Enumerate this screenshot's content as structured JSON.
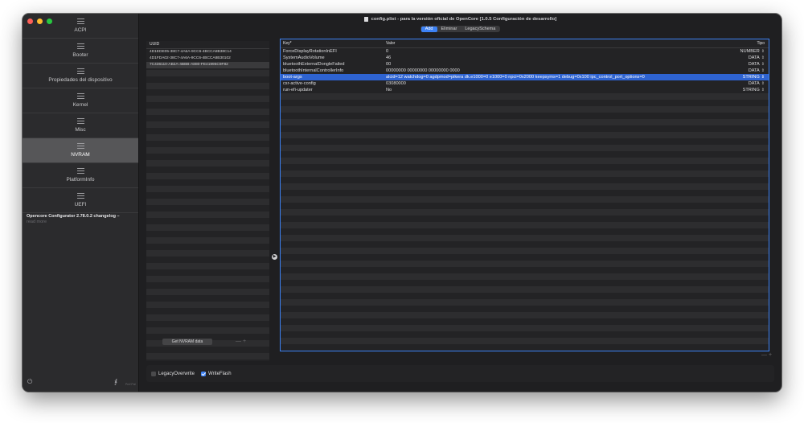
{
  "window": {
    "title": "config.plist - para la versión oficial de OpenCore [1.0.5 Configuración de desarrollo]"
  },
  "tabs": [
    "Add",
    "Eliminar",
    "LegacySchema"
  ],
  "sidebar": {
    "items": [
      {
        "label": "ACPI"
      },
      {
        "label": "Booter"
      },
      {
        "label": "Propiedades del dispositivo"
      },
      {
        "label": "Kernel"
      },
      {
        "label": "Misc"
      },
      {
        "label": "NVRAM",
        "selected": true
      },
      {
        "label": "PlatformInfo"
      },
      {
        "label": "UEFI"
      }
    ],
    "changelog_title": "Opencore Configurator 2.78.0.2 changelog –",
    "changelog_more": "read more",
    "preferences_label": "Pref Pat"
  },
  "uuid_list": {
    "header": "UUID",
    "rows": [
      "4D1EDE05-38C7-4A6A-9CC6-4BCCA8B38C14",
      "4D1FDA02-38C7-4A6A-9CC6-4BCCA8B30102",
      "7C436110-AB2A-4BBB-A880-FE41995C9F82"
    ],
    "selected_index": 2,
    "get_button": "Get NVRAM data",
    "add_remove": "— +"
  },
  "table": {
    "headers": {
      "key": "Key*",
      "value": "Valor",
      "type": "Tipo"
    },
    "rows": [
      {
        "key": "ForceDisplayRotationInEFI",
        "value": "0",
        "type": "NUMBER"
      },
      {
        "key": "SystemAudioVolume",
        "value": "46",
        "type": "DATA"
      },
      {
        "key": "bluetoothExternalDongleFailed",
        "value": "00",
        "type": "DATA"
      },
      {
        "key": "bluetoothInternalControllerInfo",
        "value": "00000000 00000000 00000000 0000",
        "type": "DATA"
      },
      {
        "key": "boot-args",
        "value": "alcid=12 watchdog=0 agdpmod=pikera dk.e1000=0 e1000=0 npci=0x2000 keepsyms=1 debug=0x100 ipc_control_port_options=0",
        "type": "STRING"
      },
      {
        "key": "csr-active-config",
        "value": "03080000",
        "type": "DATA"
      },
      {
        "key": "run-efi-updater",
        "value": "No",
        "type": "STRING"
      }
    ],
    "selected_index": 4,
    "add_remove": "— +"
  },
  "options": {
    "legacy_overwrite": {
      "label": "LegacyOverwrite",
      "checked": false
    },
    "write_flash": {
      "label": "WriteFlash",
      "checked": true
    }
  },
  "colors": {
    "accent": "#3d82f5",
    "selection": "#2e63d1"
  }
}
